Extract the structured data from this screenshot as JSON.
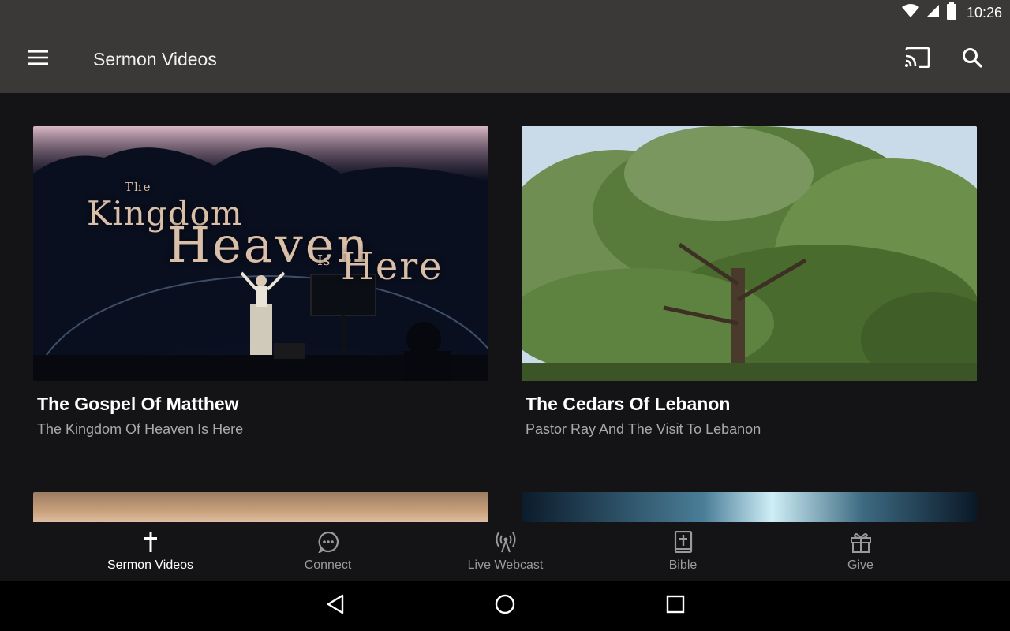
{
  "status": {
    "time": "10:26"
  },
  "appbar": {
    "title": "Sermon Videos"
  },
  "cards": [
    {
      "title": "The Gospel Of Matthew",
      "subtitle": "The Kingdom Of Heaven Is Here",
      "thumb_text": [
        "The",
        "Kingdom",
        "Heaven",
        "Is",
        "Here"
      ]
    },
    {
      "title": "The Cedars Of Lebanon",
      "subtitle": "Pastor Ray And The Visit To Lebanon"
    }
  ],
  "nav": [
    {
      "label": "Sermon Videos",
      "icon": "cross-icon",
      "active": true
    },
    {
      "label": "Connect",
      "icon": "chat-bubble-icon",
      "active": false
    },
    {
      "label": "Live Webcast",
      "icon": "broadcast-tower-icon",
      "active": false
    },
    {
      "label": "Bible",
      "icon": "bible-icon",
      "active": false
    },
    {
      "label": "Give",
      "icon": "gift-icon",
      "active": false
    }
  ],
  "colors": {
    "appbar": "#3a3937",
    "background": "#141416",
    "nav_active": "#ffffff",
    "nav_inactive": "#9a9a9a"
  }
}
